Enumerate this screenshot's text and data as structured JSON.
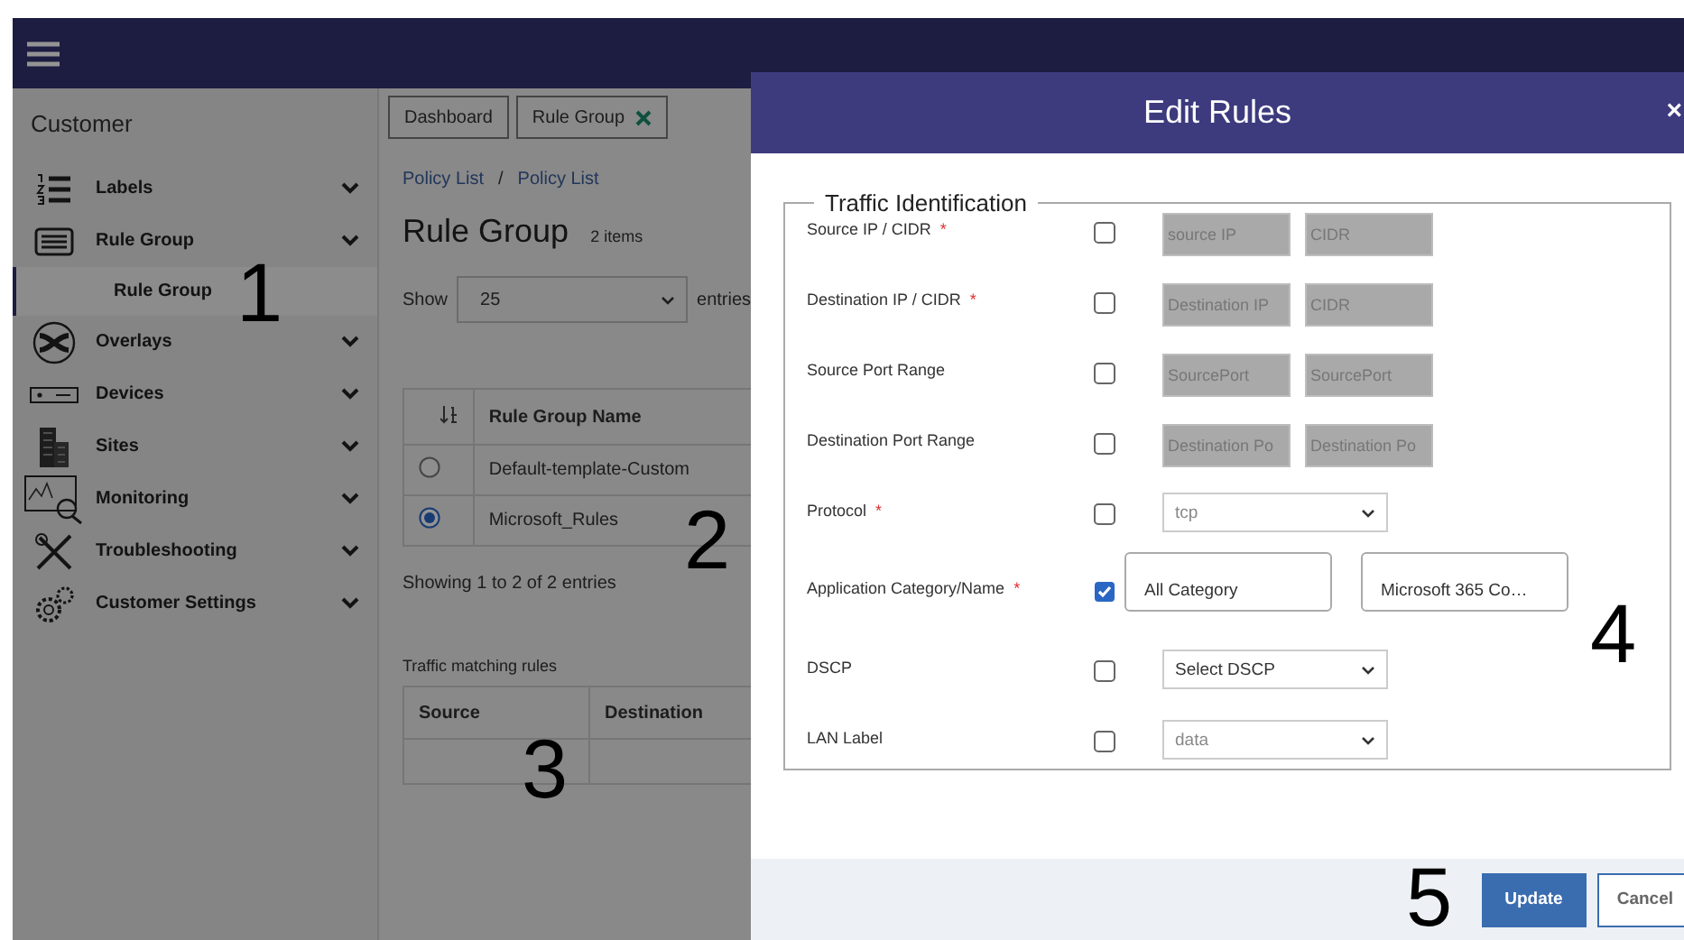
{
  "sidebar": {
    "title": "Customer",
    "items": [
      {
        "label": "Labels"
      },
      {
        "label": "Rule Group",
        "children": [
          {
            "label": "Rule Group",
            "selected": true
          }
        ]
      },
      {
        "label": "Overlays"
      },
      {
        "label": "Devices"
      },
      {
        "label": "Sites"
      },
      {
        "label": "Monitoring"
      },
      {
        "label": "Troubleshooting"
      },
      {
        "label": "Customer Settings"
      }
    ]
  },
  "tabs": [
    {
      "label": "Dashboard",
      "closable": false
    },
    {
      "label": "Rule Group",
      "closable": true
    }
  ],
  "breadcrumb": {
    "items": [
      "Policy List",
      "Policy List"
    ],
    "separator": "/"
  },
  "page": {
    "title": "Rule Group",
    "count": "2 items",
    "show_label": "Show",
    "page_size": "25",
    "entries_label": "entries"
  },
  "table": {
    "columns": [
      "Rule Group Name"
    ],
    "rows": [
      {
        "name": "Default-template-Custom",
        "selected": false
      },
      {
        "name": "Microsoft_Rules",
        "selected": true
      }
    ],
    "info": "Showing 1 to 2 of 2 entries"
  },
  "matching": {
    "title": "Traffic matching rules",
    "columns": [
      "Source",
      "Destination"
    ]
  },
  "modal": {
    "title": "Edit Rules",
    "close": "×",
    "legend": "Traffic Identification",
    "required_mark": "*",
    "rows": [
      {
        "label": "Source IP / CIDR",
        "required": true,
        "checked": false,
        "kind": "pair",
        "fields": [
          {
            "placeholder": "source IP"
          },
          {
            "placeholder": "CIDR"
          }
        ]
      },
      {
        "label": "Destination IP / CIDR",
        "required": true,
        "checked": false,
        "kind": "pair",
        "fields": [
          {
            "placeholder": "Destination IP"
          },
          {
            "placeholder": "CIDR"
          }
        ]
      },
      {
        "label": "Source Port Range",
        "required": false,
        "checked": false,
        "kind": "pair",
        "fields": [
          {
            "placeholder": "SourcePort"
          },
          {
            "placeholder": "SourcePort"
          }
        ]
      },
      {
        "label": "Destination Port Range",
        "required": false,
        "checked": false,
        "kind": "pair",
        "fields": [
          {
            "placeholder": "Destination Po"
          },
          {
            "placeholder": "Destination Po"
          }
        ]
      },
      {
        "label": "Protocol",
        "required": true,
        "checked": false,
        "kind": "select",
        "value": "tcp",
        "disabled": true
      },
      {
        "label": "Application Category/Name",
        "required": true,
        "checked": true,
        "kind": "boxes",
        "fields": [
          {
            "value": "All Category"
          },
          {
            "value": "Microsoft 365 Co…"
          }
        ]
      },
      {
        "label": "DSCP",
        "required": false,
        "checked": false,
        "kind": "select",
        "value": "Select DSCP",
        "disabled": false
      },
      {
        "label": "LAN Label",
        "required": false,
        "checked": false,
        "kind": "select",
        "value": "data",
        "disabled": true
      }
    ],
    "buttons": [
      {
        "label": "Update",
        "primary": true
      },
      {
        "label": "Cancel",
        "primary": false
      }
    ]
  },
  "callouts": [
    "1",
    "2",
    "3",
    "4",
    "5"
  ]
}
